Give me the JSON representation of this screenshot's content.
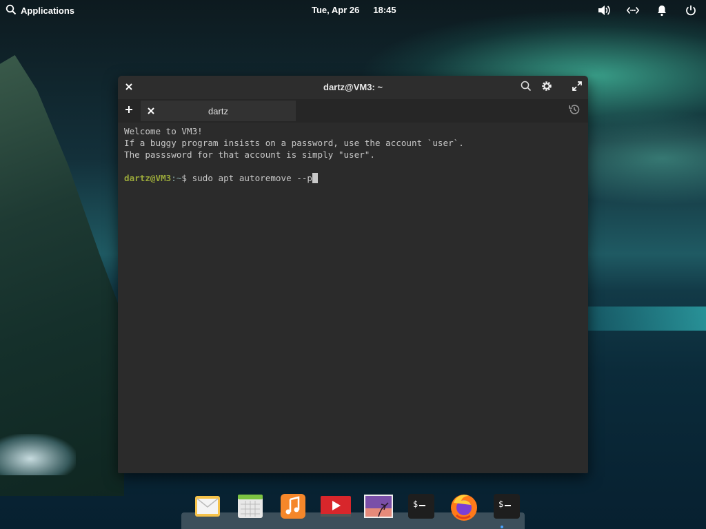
{
  "top_panel": {
    "applications_label": "Applications",
    "date": "Tue, Apr 26",
    "time": "18:45",
    "tray_icons": [
      "volume-icon",
      "network-icon",
      "notifications-icon",
      "power-icon"
    ]
  },
  "window": {
    "title": "dartz@VM3: ~",
    "tab_label": "dartz",
    "lines": [
      "Welcome to VM3!",
      "If a buggy program insists on a password, use the account `user`.",
      "The passsword for that account is simply \"user\"."
    ],
    "prompt_user": "dartz@VM3",
    "prompt_path": ":~",
    "prompt_symbol": "$ ",
    "command": "sudo apt autoremove --p"
  },
  "dock": {
    "items": [
      "mail-icon",
      "calendar-icon",
      "music-icon",
      "videos-icon",
      "photos-icon",
      "terminal-icon",
      "firefox-icon",
      "terminal-icon"
    ]
  },
  "colors": {
    "prompt_user": "#9aa83a",
    "terminal_bg": "#2b2b2b",
    "terminal_text": "#c8c8c8"
  }
}
